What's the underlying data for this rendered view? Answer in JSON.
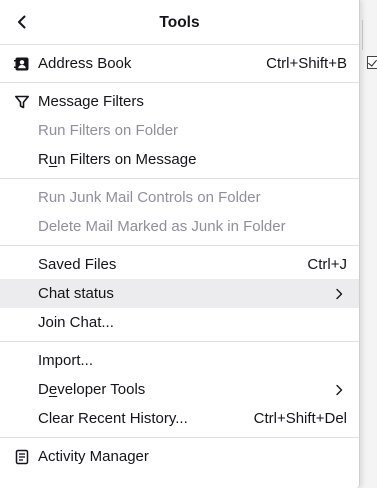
{
  "menu": {
    "title": "Tools",
    "address_book": {
      "label": "Address Book",
      "shortcut": "Ctrl+Shift+B"
    },
    "message_filters": {
      "label": "Message Filters"
    },
    "run_filters_folder": {
      "label": "Run Filters on Folder"
    },
    "run_filters_message": {
      "pre": "R",
      "mnemonic": "u",
      "post": "n Filters on Message"
    },
    "run_junk": {
      "label": "Run Junk Mail Controls on Folder"
    },
    "delete_junk": {
      "label": "Delete Mail Marked as Junk in Folder"
    },
    "saved_files": {
      "label": "Saved Files",
      "shortcut": "Ctrl+J"
    },
    "chat_status": {
      "label": "Chat status"
    },
    "join_chat": {
      "label": "Join Chat..."
    },
    "import": {
      "label": "Import..."
    },
    "developer_tools": {
      "pre": "D",
      "mnemonic": "e",
      "post": "veloper Tools"
    },
    "clear_history": {
      "label": "Clear Recent History...",
      "shortcut": "Ctrl+Shift+Del"
    },
    "activity_manager": {
      "label": "Activity Manager"
    }
  },
  "icons": {
    "back": "chevron-left-icon",
    "address_book": "address-book-icon",
    "filter": "filter-funnel-icon",
    "submenu": "chevron-right-icon",
    "activity": "activity-manager-icon"
  },
  "colors": {
    "text": "#15141a",
    "disabled": "#8f8f9d",
    "hover": "#ececef",
    "separator": "#e0e0e0"
  }
}
